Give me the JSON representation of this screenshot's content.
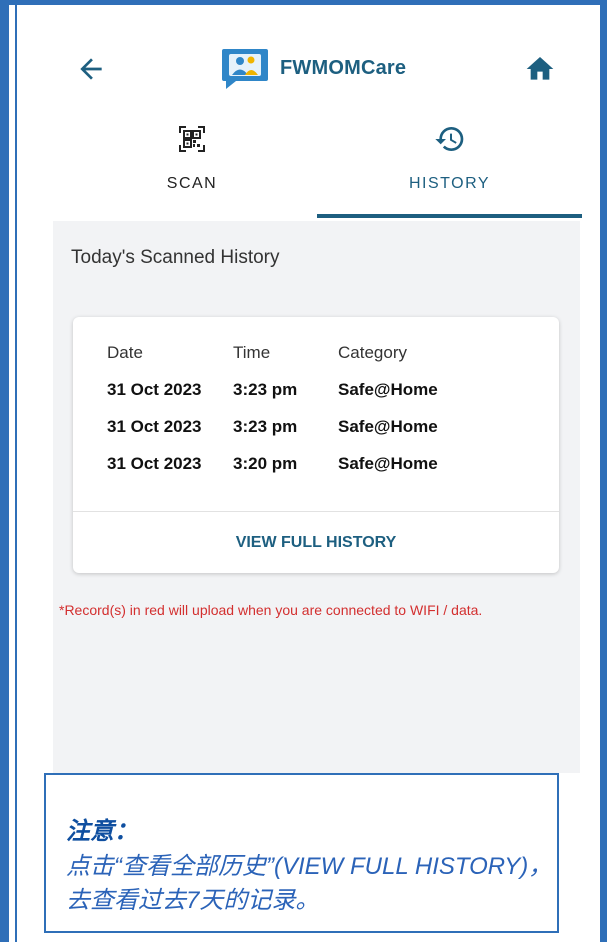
{
  "header": {
    "app_name": "FWMOMCare",
    "back_icon": "arrow-left-icon",
    "home_icon": "home-icon",
    "logo_icon": "app-logo-icon"
  },
  "tabs": [
    {
      "label": "SCAN",
      "icon": "qr-code-icon",
      "active": false
    },
    {
      "label": "HISTORY",
      "icon": "history-icon",
      "active": true
    }
  ],
  "history": {
    "section_title": "Today's Scanned History",
    "columns": [
      "Date",
      "Time",
      "Category"
    ],
    "rows": [
      {
        "date": "31 Oct 2023",
        "time": "3:23 pm",
        "category": "Safe@Home"
      },
      {
        "date": "31 Oct 2023",
        "time": "3:23 pm",
        "category": "Safe@Home"
      },
      {
        "date": "31 Oct 2023",
        "time": "3:20 pm",
        "category": "Safe@Home"
      }
    ],
    "view_full_label": "VIEW FULL HISTORY",
    "notice": "*Record(s) in red will upload when you are connected to WIFI / data."
  },
  "note": {
    "title": "注意：",
    "body": "点击“查看全部历史”(VIEW FULL HISTORY)，去查看过去7天的记录。"
  },
  "colors": {
    "accent": "#1d5f80",
    "frame": "#2f6fb8",
    "notice": "#d32f2f",
    "content_bg": "#f2f3f5"
  }
}
